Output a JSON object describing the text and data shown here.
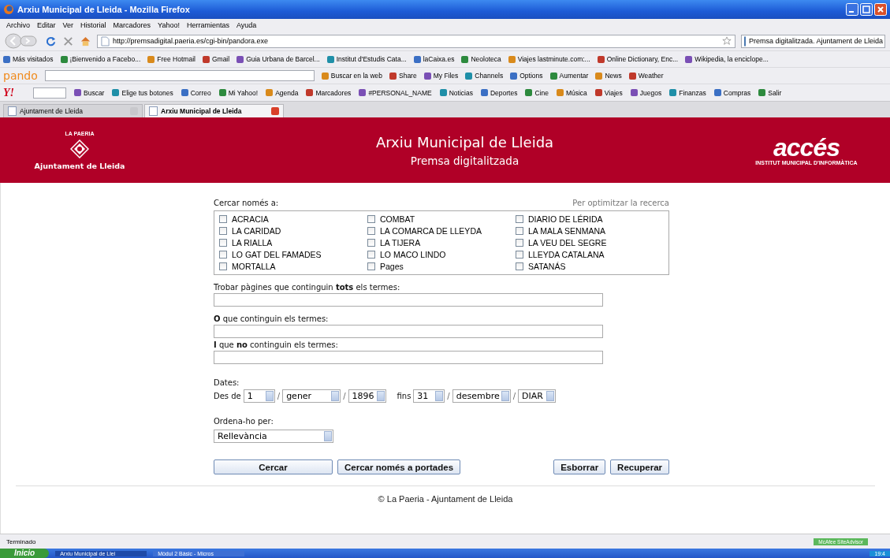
{
  "window": {
    "title": "Arxiu Municipal de Lleida - Mozilla Firefox"
  },
  "menu": [
    "Archivo",
    "Editar",
    "Ver",
    "Historial",
    "Marcadores",
    "Yahoo!",
    "Herramientas",
    "Ayuda"
  ],
  "navigation": {
    "url": "http://premsadigital.paeria.es/cgi-bin/pandora.exe",
    "search": "Premsa digitalitzada. Ajuntament de Lleida"
  },
  "bookmarks": [
    "Más visitados",
    "¡Bienvenido a Facebo...",
    "Free Hotmail",
    "Gmail",
    "Guia Urbana de Barcel...",
    "Institut d'Estudis Cata...",
    "laCaixa.es",
    "Neoloteca",
    "Viajes lastminute.com:...",
    "Online Dictionary, Enc...",
    "Wikipedia, la enciclope..."
  ],
  "pando_toolbar": {
    "logo": "pando",
    "items": [
      "Buscar en la web",
      "Share",
      "My Files",
      "Channels",
      "Options",
      "Aumentar",
      "News",
      "Weather"
    ]
  },
  "yahoo_toolbar": {
    "logo": "Y!",
    "items": [
      "Buscar",
      "Elige tus botones",
      "Correo",
      "Mi Yahoo!",
      "Agenda",
      "Marcadores",
      "#PERSONAL_NAME",
      "Noticias",
      "Deportes",
      "Cine",
      "Música",
      "Viajes",
      "Juegos",
      "Finanzas",
      "Compras",
      "Salir"
    ]
  },
  "tabs": [
    {
      "label": "Ajuntament de Lleida",
      "selected": false
    },
    {
      "label": "Arxiu Municipal de Lleida",
      "selected": true
    }
  ],
  "banner": {
    "org_top": "LA PAERIA",
    "org_name": "Ajuntament de Lleida",
    "title": "Arxiu Municipal de Lleida",
    "subtitle": "Premsa digitalitzada",
    "partner_logo": "accés",
    "partner_name": "INSTITUT MUNICIPAL D'INFORMÀTICA"
  },
  "form": {
    "filter_label": "Cercar només a:",
    "hint": "Per optimitzar la recerca",
    "publications": [
      {
        "name": "ACRACIA",
        "checked": false
      },
      {
        "name": "COMBAT",
        "checked": false
      },
      {
        "name": "DIARIO DE LÉRIDA",
        "checked": false
      },
      {
        "name": "LA CARIDAD",
        "checked": false
      },
      {
        "name": "LA COMARCA DE LLEYDA",
        "checked": false
      },
      {
        "name": "LA MALA SENMANA",
        "checked": false
      },
      {
        "name": "LA RIALLA",
        "checked": false
      },
      {
        "name": "LA TIJERA",
        "checked": false
      },
      {
        "name": "LA VEU DEL SEGRE",
        "checked": false
      },
      {
        "name": "LO GAT DEL FAMADES",
        "checked": false
      },
      {
        "name": "LO MACO LINDO",
        "checked": false
      },
      {
        "name": "LLEYDA CATALANA",
        "checked": false
      },
      {
        "name": "MORTALLA",
        "checked": false
      },
      {
        "name": "Pages",
        "checked": false
      },
      {
        "name": "SATANÁS",
        "checked": false
      }
    ],
    "fields": [
      {
        "label": "Trobar pàgines que continguin **tots** els termes:"
      },
      {
        "label": "**O** que continguin els termes:"
      },
      {
        "label": "**I** que **no** continguin els termes:"
      }
    ],
    "dates_label": "Dates:",
    "date_ranges": [
      {
        "label": "Des de",
        "parts": [
          {
            "value": "1"
          },
          {
            "sep": "/",
            "value": "gener"
          },
          {
            "sep": "/",
            "value": "1896"
          }
        ]
      },
      {
        "label": "fins",
        "parts": [
          {
            "value": "31"
          },
          {
            "sep": "/",
            "value": "desembre"
          },
          {
            "sep": "/",
            "value": "DIAR"
          }
        ]
      }
    ],
    "sort": {
      "label": "Ordena-ho per:",
      "value": "Rellevància"
    },
    "buttons_left": [
      "Cercar",
      "Cercar només a portades"
    ],
    "buttons_right": [
      "Esborrar",
      "Recuperar"
    ]
  },
  "footer": "© La Paeria - Ajuntament de Lleida",
  "status_bar": {
    "text": "Terminado",
    "addon": "McAfee SiteAdvisor"
  },
  "taskbar": {
    "start": "Inicio",
    "tasks": [
      {
        "label": "Arxiu Municipal de Llei",
        "selected": true
      },
      {
        "label": "Mòdul 2 Bàsic - Micros",
        "selected": false
      }
    ],
    "clock": "19:4"
  }
}
